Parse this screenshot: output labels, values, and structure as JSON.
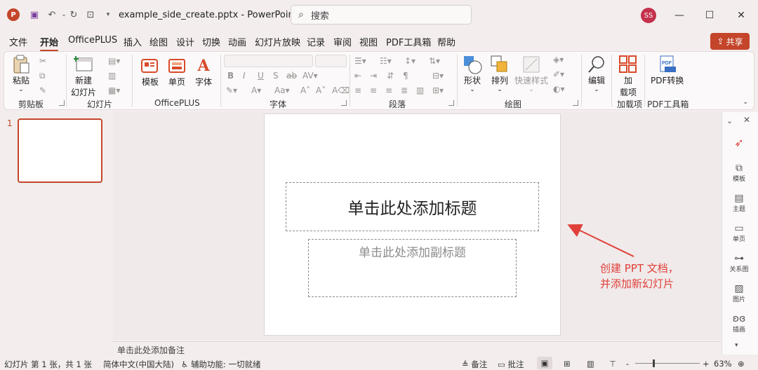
{
  "window": {
    "title": "example_side_create.pptx  -  PowerPoint",
    "search_placeholder": "搜索",
    "avatar_initials": "SS",
    "app_logo": "P"
  },
  "tabs": [
    "文件",
    "开始",
    "OfficePLUS",
    "插入",
    "绘图",
    "设计",
    "切换",
    "动画",
    "幻灯片放映",
    "记录",
    "审阅",
    "视图",
    "PDF工具箱",
    "帮助"
  ],
  "active_tab": "开始",
  "share_label": "共享",
  "ribbon": {
    "paste": "粘贴",
    "new_slide_1": "新建",
    "new_slide_2": "幻灯片",
    "template": "模板",
    "single_page": "单页",
    "font_btn": "字体",
    "shape": "形状",
    "arrange": "排列",
    "quick_style": "快速样式",
    "edit": "编辑",
    "addin_1": "加",
    "addin_2": "载项",
    "pdf_convert": "PDF转换",
    "groups": {
      "clipboard": "剪贴板",
      "slides": "幻灯片",
      "officeplus": "OfficePLUS",
      "font": "字体",
      "paragraph": "段落",
      "drawing": "绘图",
      "addins": "加载项",
      "pdf": "PDF工具箱"
    }
  },
  "thumbnail": {
    "number": "1"
  },
  "slide": {
    "title_placeholder": "单击此处添加标题",
    "subtitle_placeholder": "单击此处添加副标题"
  },
  "annotation": {
    "line1": "创建 PPT 文档，",
    "line2": "并添加新幻灯片",
    "color": "#e0403a"
  },
  "right_pane": [
    "模板",
    "主题",
    "单页",
    "关系图",
    "图片",
    "插画"
  ],
  "notes_placeholder": "单击此处添加备注",
  "status": {
    "slide_info": "幻灯片 第 1 张，共 1 张",
    "language": "简体中文(中国大陆)",
    "accessibility": "辅助功能: 一切就绪",
    "notes_btn": "备注",
    "comments_btn": "批注",
    "zoom": "63%",
    "zoom_minus": "-",
    "zoom_plus": "+"
  },
  "accent_color": "#c4452a"
}
